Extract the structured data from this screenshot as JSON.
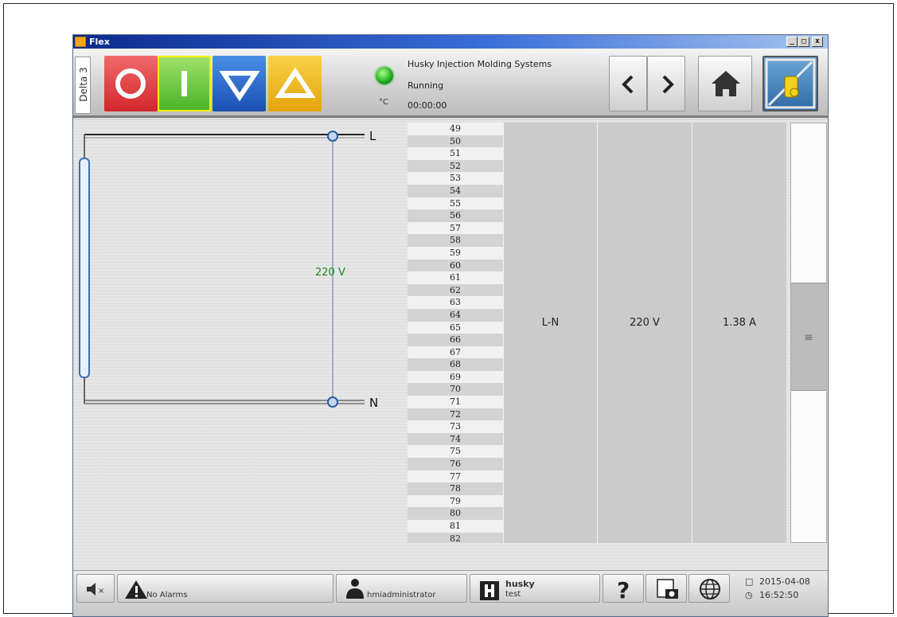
{
  "window": {
    "title": "Flex"
  },
  "toolbar": {
    "machine_tab": "Delta 3",
    "unit": "°C",
    "company": "Husky Injection Molding Systems",
    "state": "Running",
    "cycle_time": "00:00:00",
    "buttons": [
      "stop-icon",
      "start-icon",
      "down-arrow-icon",
      "up-arrow-icon",
      "chevron-left-icon",
      "chevron-right-icon",
      "home-icon",
      "lock-icon"
    ]
  },
  "diagram": {
    "line_label": "L",
    "neutral_label": "N",
    "voltage": "220 V"
  },
  "table": {
    "row_numbers": [
      "49",
      "50",
      "51",
      "52",
      "53",
      "54",
      "55",
      "56",
      "57",
      "58",
      "59",
      "60",
      "61",
      "62",
      "63",
      "64",
      "65",
      "66",
      "67",
      "68",
      "69",
      "70",
      "71",
      "72",
      "73",
      "74",
      "75",
      "76",
      "77",
      "78",
      "79",
      "80",
      "81",
      "82"
    ],
    "phase": "L-N",
    "voltage": "220 V",
    "current": "1.38 A"
  },
  "footer": {
    "alarms": "No Alarms",
    "user": "hmiadministrator",
    "machine_name": "husky",
    "machine_sub": "test",
    "date": "2015-04-08",
    "time": "16:52:50"
  },
  "colors": {
    "voltage_text": "#1a8a1a",
    "led": "#1ea81e",
    "stop": "#d2262a",
    "start": "#4cb42a",
    "down": "#1a4fb2",
    "up": "#e3a40a"
  }
}
